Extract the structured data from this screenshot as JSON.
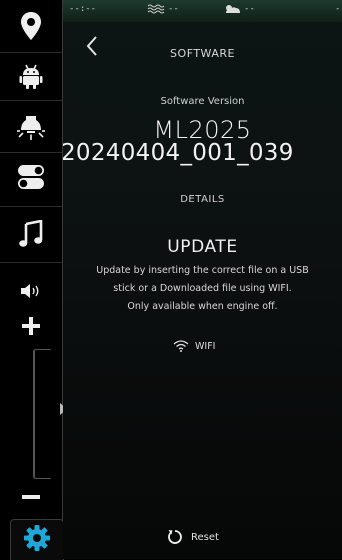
{
  "sidebar": {
    "items": [
      {
        "name": "location-pin-icon"
      },
      {
        "name": "android-auto-icon"
      },
      {
        "name": "light-bulb-icon"
      },
      {
        "name": "toggle-switches-icon"
      },
      {
        "name": "music-note-icon"
      }
    ],
    "volume": {
      "level": 0.0
    },
    "active": "settings-gear-icon"
  },
  "statusbar": {
    "item1": "--:--",
    "item2": "--",
    "item3": "--",
    "item4": "-"
  },
  "header": {
    "title": "SOFTWARE"
  },
  "software": {
    "version_label": "Software Version",
    "version_line1": "ML2025",
    "version_line2": "20240404_001_039",
    "details_label": "DETAILS"
  },
  "update": {
    "title": "UPDATE",
    "line1": "Update by inserting the correct file on a USB",
    "line2": "stick or a Downloaded file using WIFI.",
    "line3": "Only available when engine off.",
    "wifi_label": "WIFI"
  },
  "footer": {
    "reset_label": "Reset"
  },
  "colors": {
    "background": "#000000",
    "accent": "#1ea8d8",
    "text": "#e8e8e8"
  }
}
